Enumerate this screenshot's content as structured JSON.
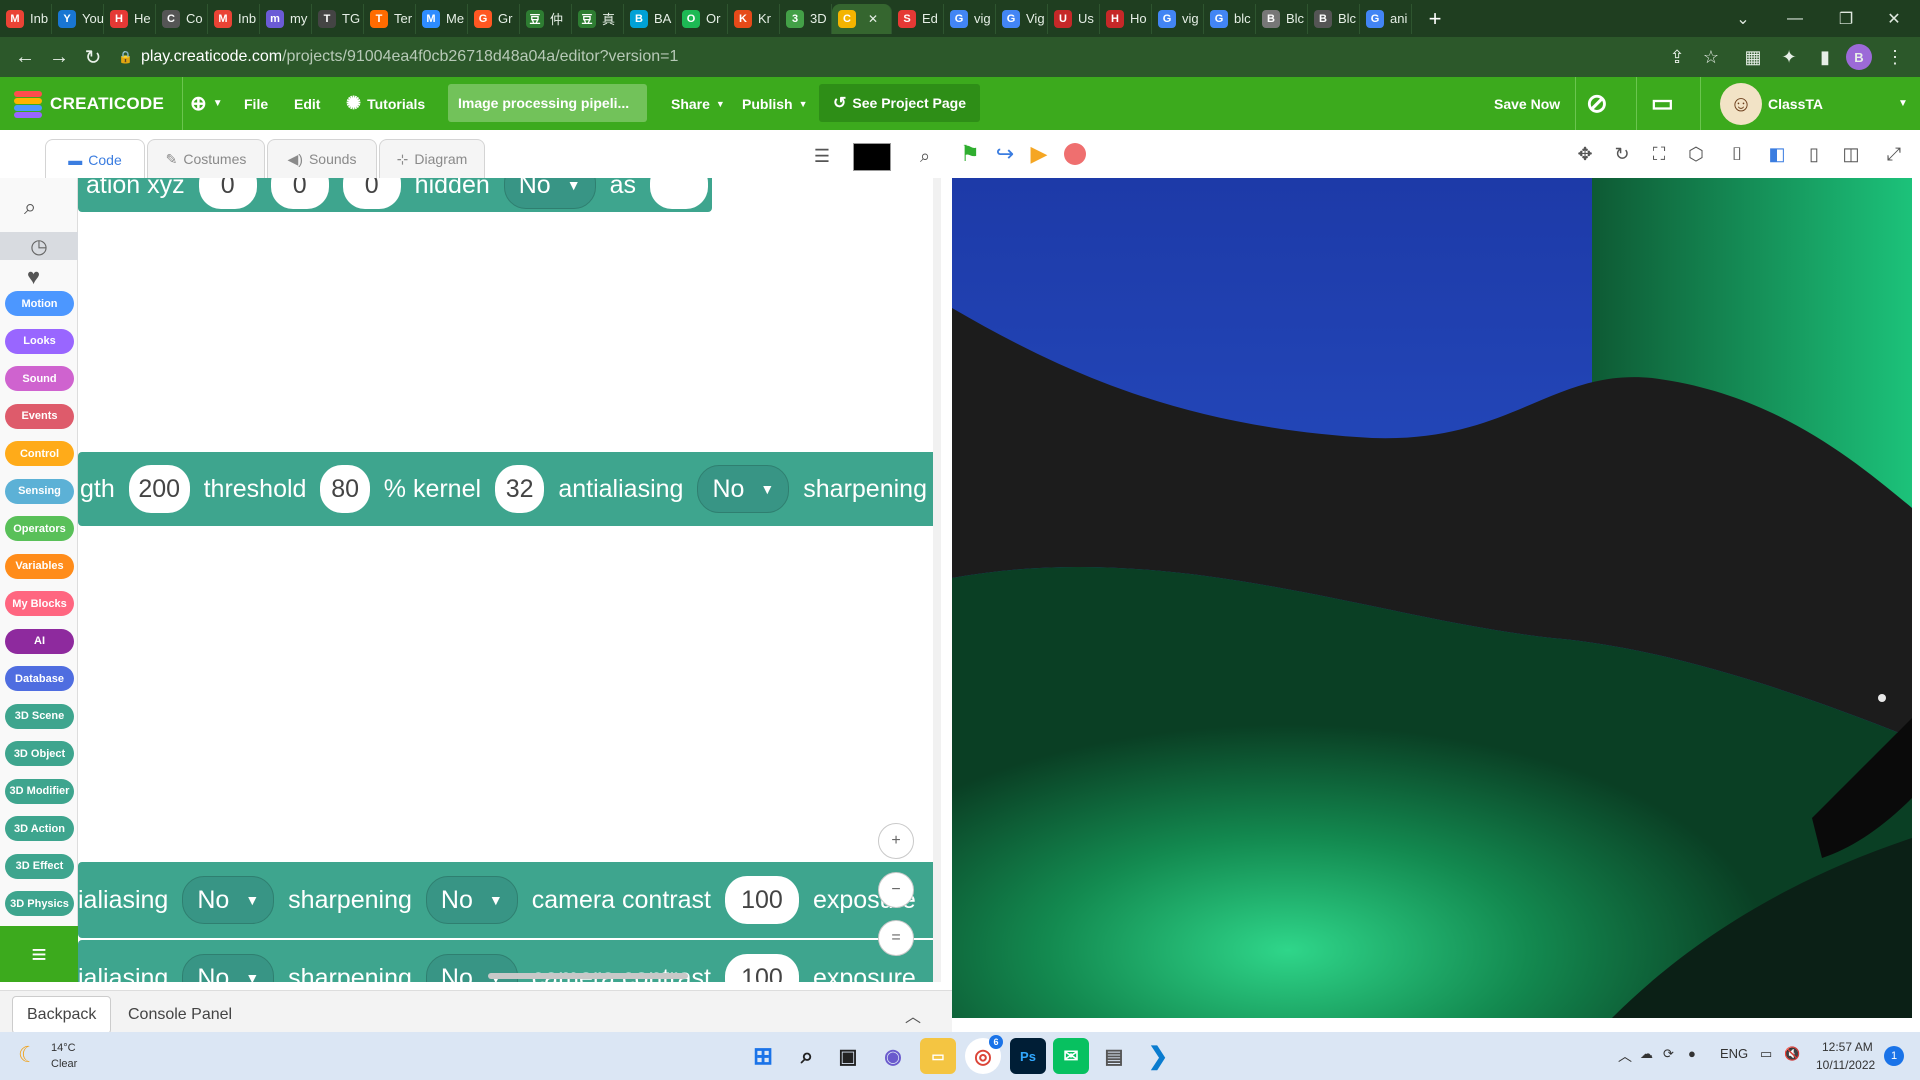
{
  "browser": {
    "tabs": [
      {
        "favicon": "M",
        "label": "Inb",
        "color": "#ea4335"
      },
      {
        "favicon": "Y",
        "label": "You",
        "color": "#1976d2"
      },
      {
        "favicon": "H",
        "label": "He",
        "color": "#e53935"
      },
      {
        "favicon": "C",
        "label": "Co",
        "color": "#555555"
      },
      {
        "favicon": "M",
        "label": "Inb",
        "color": "#ea4335"
      },
      {
        "favicon": "m",
        "label": "my",
        "color": "#6b5bd6"
      },
      {
        "favicon": "T",
        "label": "TG",
        "color": "#444444"
      },
      {
        "favicon": "T",
        "label": "Ter",
        "color": "#ff6b00"
      },
      {
        "favicon": "M",
        "label": "Me",
        "color": "#2d8cff"
      },
      {
        "favicon": "G",
        "label": "Gr",
        "color": "#ff5722"
      },
      {
        "favicon": "豆",
        "label": "仲",
        "color": "#2e7d32"
      },
      {
        "favicon": "豆",
        "label": "真",
        "color": "#2e7d32"
      },
      {
        "favicon": "B",
        "label": "BA",
        "color": "#00a1d6"
      },
      {
        "favicon": "O",
        "label": "Or",
        "color": "#1db954"
      },
      {
        "favicon": "K",
        "label": "Kr",
        "color": "#e64a19"
      },
      {
        "favicon": "3",
        "label": "3D",
        "color": "#43a047"
      },
      {
        "favicon": "C",
        "label": "",
        "color": "#f4b400"
      },
      {
        "favicon": "S",
        "label": "Ed",
        "color": "#e53935"
      },
      {
        "favicon": "G",
        "label": "vig",
        "color": "#4285f4"
      },
      {
        "favicon": "G",
        "label": "Vig",
        "color": "#4285f4"
      },
      {
        "favicon": "U",
        "label": "Us",
        "color": "#c62828"
      },
      {
        "favicon": "H",
        "label": "Ho",
        "color": "#c62828"
      },
      {
        "favicon": "G",
        "label": "vig",
        "color": "#4285f4"
      },
      {
        "favicon": "G",
        "label": "blc",
        "color": "#4285f4"
      },
      {
        "favicon": "B",
        "label": "Blc",
        "color": "#777777"
      },
      {
        "favicon": "B",
        "label": "Blc",
        "color": "#555555"
      },
      {
        "favicon": "G",
        "label": "ani",
        "color": "#4285f4"
      }
    ],
    "active_tab_close": "✕",
    "new_tab": "+",
    "window_controls": [
      "⌄",
      "—",
      "❐",
      "✕"
    ],
    "url_host": "play.creaticode.com",
    "url_path": "/projects/91004ea4f0cb26718d48a04a/editor?version=1",
    "profile_initial": "B"
  },
  "app": {
    "brand": "CREATICODE",
    "menu_file": "File",
    "menu_edit": "Edit",
    "tutorials": "Tutorials",
    "project_title": "Image processing pipeli...",
    "share": "Share",
    "publish": "Publish",
    "see_project": "See Project Page",
    "save_now": "Save Now",
    "username": "ClassTA",
    "accent": "#3caa1d"
  },
  "editor_tabs": {
    "code": "Code",
    "costumes": "Costumes",
    "sounds": "Sounds",
    "diagram": "Diagram"
  },
  "categories": [
    {
      "label": "Motion",
      "color": "#4c97ff"
    },
    {
      "label": "Looks",
      "color": "#9966ff"
    },
    {
      "label": "Sound",
      "color": "#cf63cf"
    },
    {
      "label": "Events",
      "color": "#de5b6b"
    },
    {
      "label": "Control",
      "color": "#ffab19"
    },
    {
      "label": "Sensing",
      "color": "#5cb1d6"
    },
    {
      "label": "Operators",
      "color": "#59c059"
    },
    {
      "label": "Variables",
      "color": "#ff8c1a"
    },
    {
      "label": "My Blocks",
      "color": "#ff6680"
    },
    {
      "label": "AI",
      "color": "#8e2a9e"
    },
    {
      "label": "Database",
      "color": "#4f6de0"
    },
    {
      "label": "3D Scene",
      "color": "#3ea58e"
    },
    {
      "label": "3D Object",
      "color": "#3ea58e"
    },
    {
      "label": "3D Modifier",
      "color": "#3ea58e"
    },
    {
      "label": "3D Action",
      "color": "#3ea58e"
    },
    {
      "label": "3D Effect",
      "color": "#3ea58e"
    },
    {
      "label": "3D Physics",
      "color": "#3ea58e"
    }
  ],
  "blocks": {
    "top": {
      "t1": "ation xyz",
      "v1": "0",
      "v2": "0",
      "v3": "0",
      "t2": "hidden",
      "dd": "No",
      "t3": "as",
      "v4": ""
    },
    "middle": {
      "t1": "gth",
      "v1": "200",
      "t2": "threshold",
      "v2": "80",
      "t3": "% kernel",
      "v3": "32",
      "t4": "antialiasing",
      "dd1": "No",
      "t5": "sharpening"
    },
    "row3": {
      "t1": "ialiasing",
      "dd1": "No",
      "t2": "sharpening",
      "dd2": "No",
      "t3": "camera contrast",
      "v1": "100",
      "t4": "exposure"
    },
    "row4": {
      "t1": "ialiasing",
      "dd1": "No",
      "t2": "sharpening",
      "dd2": "No",
      "t3": "camera contrast",
      "v1": "100",
      "t4": "exposure"
    }
  },
  "zoom": {
    "in": "+",
    "out": "−",
    "reset": "="
  },
  "bottom_panel": {
    "backpack": "Backpack",
    "console": "Console Panel"
  },
  "taskbar": {
    "weather_temp": "14°C",
    "weather_desc": "Clear",
    "lang": "ENG",
    "time": "12:57 AM",
    "date": "10/11/2022",
    "notif_count": "1",
    "chrome_badge": "6"
  }
}
